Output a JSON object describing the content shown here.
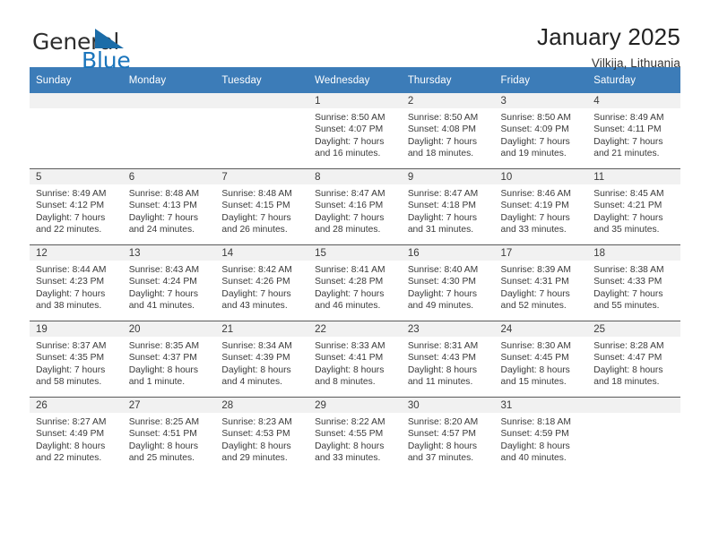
{
  "brand": {
    "name_part1": "General",
    "name_part2": "Blue"
  },
  "header": {
    "title": "January 2025",
    "location": "Vilkija, Lithuania"
  },
  "colors": {
    "header_blue": "#3c7cb8",
    "brand_blue": "#1b75bc",
    "daynum_band": "#f1f1f1",
    "row_divider": "#5a5a5a"
  },
  "weekdays": [
    "Sunday",
    "Monday",
    "Tuesday",
    "Wednesday",
    "Thursday",
    "Friday",
    "Saturday"
  ],
  "weeks": [
    [
      {
        "day": "",
        "sunrise": "",
        "sunset": "",
        "daylight1": "",
        "daylight2": ""
      },
      {
        "day": "",
        "sunrise": "",
        "sunset": "",
        "daylight1": "",
        "daylight2": ""
      },
      {
        "day": "",
        "sunrise": "",
        "sunset": "",
        "daylight1": "",
        "daylight2": ""
      },
      {
        "day": "1",
        "sunrise": "Sunrise: 8:50 AM",
        "sunset": "Sunset: 4:07 PM",
        "daylight1": "Daylight: 7 hours",
        "daylight2": "and 16 minutes."
      },
      {
        "day": "2",
        "sunrise": "Sunrise: 8:50 AM",
        "sunset": "Sunset: 4:08 PM",
        "daylight1": "Daylight: 7 hours",
        "daylight2": "and 18 minutes."
      },
      {
        "day": "3",
        "sunrise": "Sunrise: 8:50 AM",
        "sunset": "Sunset: 4:09 PM",
        "daylight1": "Daylight: 7 hours",
        "daylight2": "and 19 minutes."
      },
      {
        "day": "4",
        "sunrise": "Sunrise: 8:49 AM",
        "sunset": "Sunset: 4:11 PM",
        "daylight1": "Daylight: 7 hours",
        "daylight2": "and 21 minutes."
      }
    ],
    [
      {
        "day": "5",
        "sunrise": "Sunrise: 8:49 AM",
        "sunset": "Sunset: 4:12 PM",
        "daylight1": "Daylight: 7 hours",
        "daylight2": "and 22 minutes."
      },
      {
        "day": "6",
        "sunrise": "Sunrise: 8:48 AM",
        "sunset": "Sunset: 4:13 PM",
        "daylight1": "Daylight: 7 hours",
        "daylight2": "and 24 minutes."
      },
      {
        "day": "7",
        "sunrise": "Sunrise: 8:48 AM",
        "sunset": "Sunset: 4:15 PM",
        "daylight1": "Daylight: 7 hours",
        "daylight2": "and 26 minutes."
      },
      {
        "day": "8",
        "sunrise": "Sunrise: 8:47 AM",
        "sunset": "Sunset: 4:16 PM",
        "daylight1": "Daylight: 7 hours",
        "daylight2": "and 28 minutes."
      },
      {
        "day": "9",
        "sunrise": "Sunrise: 8:47 AM",
        "sunset": "Sunset: 4:18 PM",
        "daylight1": "Daylight: 7 hours",
        "daylight2": "and 31 minutes."
      },
      {
        "day": "10",
        "sunrise": "Sunrise: 8:46 AM",
        "sunset": "Sunset: 4:19 PM",
        "daylight1": "Daylight: 7 hours",
        "daylight2": "and 33 minutes."
      },
      {
        "day": "11",
        "sunrise": "Sunrise: 8:45 AM",
        "sunset": "Sunset: 4:21 PM",
        "daylight1": "Daylight: 7 hours",
        "daylight2": "and 35 minutes."
      }
    ],
    [
      {
        "day": "12",
        "sunrise": "Sunrise: 8:44 AM",
        "sunset": "Sunset: 4:23 PM",
        "daylight1": "Daylight: 7 hours",
        "daylight2": "and 38 minutes."
      },
      {
        "day": "13",
        "sunrise": "Sunrise: 8:43 AM",
        "sunset": "Sunset: 4:24 PM",
        "daylight1": "Daylight: 7 hours",
        "daylight2": "and 41 minutes."
      },
      {
        "day": "14",
        "sunrise": "Sunrise: 8:42 AM",
        "sunset": "Sunset: 4:26 PM",
        "daylight1": "Daylight: 7 hours",
        "daylight2": "and 43 minutes."
      },
      {
        "day": "15",
        "sunrise": "Sunrise: 8:41 AM",
        "sunset": "Sunset: 4:28 PM",
        "daylight1": "Daylight: 7 hours",
        "daylight2": "and 46 minutes."
      },
      {
        "day": "16",
        "sunrise": "Sunrise: 8:40 AM",
        "sunset": "Sunset: 4:30 PM",
        "daylight1": "Daylight: 7 hours",
        "daylight2": "and 49 minutes."
      },
      {
        "day": "17",
        "sunrise": "Sunrise: 8:39 AM",
        "sunset": "Sunset: 4:31 PM",
        "daylight1": "Daylight: 7 hours",
        "daylight2": "and 52 minutes."
      },
      {
        "day": "18",
        "sunrise": "Sunrise: 8:38 AM",
        "sunset": "Sunset: 4:33 PM",
        "daylight1": "Daylight: 7 hours",
        "daylight2": "and 55 minutes."
      }
    ],
    [
      {
        "day": "19",
        "sunrise": "Sunrise: 8:37 AM",
        "sunset": "Sunset: 4:35 PM",
        "daylight1": "Daylight: 7 hours",
        "daylight2": "and 58 minutes."
      },
      {
        "day": "20",
        "sunrise": "Sunrise: 8:35 AM",
        "sunset": "Sunset: 4:37 PM",
        "daylight1": "Daylight: 8 hours",
        "daylight2": "and 1 minute."
      },
      {
        "day": "21",
        "sunrise": "Sunrise: 8:34 AM",
        "sunset": "Sunset: 4:39 PM",
        "daylight1": "Daylight: 8 hours",
        "daylight2": "and 4 minutes."
      },
      {
        "day": "22",
        "sunrise": "Sunrise: 8:33 AM",
        "sunset": "Sunset: 4:41 PM",
        "daylight1": "Daylight: 8 hours",
        "daylight2": "and 8 minutes."
      },
      {
        "day": "23",
        "sunrise": "Sunrise: 8:31 AM",
        "sunset": "Sunset: 4:43 PM",
        "daylight1": "Daylight: 8 hours",
        "daylight2": "and 11 minutes."
      },
      {
        "day": "24",
        "sunrise": "Sunrise: 8:30 AM",
        "sunset": "Sunset: 4:45 PM",
        "daylight1": "Daylight: 8 hours",
        "daylight2": "and 15 minutes."
      },
      {
        "day": "25",
        "sunrise": "Sunrise: 8:28 AM",
        "sunset": "Sunset: 4:47 PM",
        "daylight1": "Daylight: 8 hours",
        "daylight2": "and 18 minutes."
      }
    ],
    [
      {
        "day": "26",
        "sunrise": "Sunrise: 8:27 AM",
        "sunset": "Sunset: 4:49 PM",
        "daylight1": "Daylight: 8 hours",
        "daylight2": "and 22 minutes."
      },
      {
        "day": "27",
        "sunrise": "Sunrise: 8:25 AM",
        "sunset": "Sunset: 4:51 PM",
        "daylight1": "Daylight: 8 hours",
        "daylight2": "and 25 minutes."
      },
      {
        "day": "28",
        "sunrise": "Sunrise: 8:23 AM",
        "sunset": "Sunset: 4:53 PM",
        "daylight1": "Daylight: 8 hours",
        "daylight2": "and 29 minutes."
      },
      {
        "day": "29",
        "sunrise": "Sunrise: 8:22 AM",
        "sunset": "Sunset: 4:55 PM",
        "daylight1": "Daylight: 8 hours",
        "daylight2": "and 33 minutes."
      },
      {
        "day": "30",
        "sunrise": "Sunrise: 8:20 AM",
        "sunset": "Sunset: 4:57 PM",
        "daylight1": "Daylight: 8 hours",
        "daylight2": "and 37 minutes."
      },
      {
        "day": "31",
        "sunrise": "Sunrise: 8:18 AM",
        "sunset": "Sunset: 4:59 PM",
        "daylight1": "Daylight: 8 hours",
        "daylight2": "and 40 minutes."
      },
      {
        "day": "",
        "sunrise": "",
        "sunset": "",
        "daylight1": "",
        "daylight2": ""
      }
    ]
  ]
}
